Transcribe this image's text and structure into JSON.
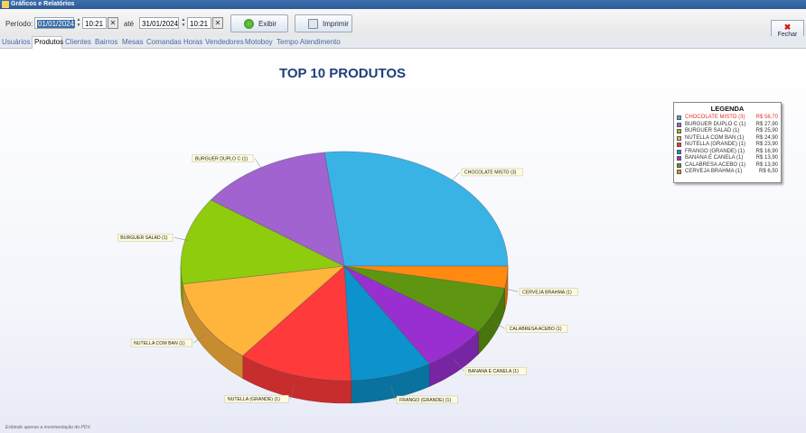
{
  "window": {
    "title": "Gráficos e Relatórios"
  },
  "toolbar": {
    "periodo_label": "Período:",
    "date_from": "01/01/2024",
    "time_from": "10:21",
    "ate_label": "até",
    "date_to": "31/01/2024",
    "time_to": "10:21",
    "exibir_label": "Exibir",
    "imprimir_label": "Imprimir",
    "fechar_label": "Fechar"
  },
  "tabs": [
    "Usuários",
    "Produtos",
    "Clientes",
    "Bairros",
    "Mesas",
    "Comandas",
    "Horas",
    "Vendedores",
    "Motoboy",
    "Tempo Atendimento"
  ],
  "active_tab": "Produtos",
  "footer_note": "Exibindo apenas a movimentação do PDV.",
  "chart_data": {
    "type": "pie",
    "title": "TOP 10 PRODUTOS",
    "legend_title": "LEGENDA",
    "legend_placement": "top-right",
    "slices": [
      {
        "label": "CHOCOLATE MISTO (3)",
        "legend_label": "CHOCOLATE MISTO (3)",
        "value": 56.7,
        "value_text": "R$ 56,70",
        "color": "#39b3e6"
      },
      {
        "label": "CERVEJA BRAHMA (1)",
        "legend_label": "CERVEJA BRAHMA (1)",
        "value": 6.5,
        "value_text": "R$ 6,50",
        "color": "#ff8a0f"
      },
      {
        "label": "CALABRESA ACEBO (1)",
        "legend_label": "CALABRESA ACEBO (1)",
        "value": 13.9,
        "value_text": "R$ 13,90",
        "color": "#5e9611"
      },
      {
        "label": "BANANA E CANELA (1)",
        "legend_label": "BANANA E CANELA (1)",
        "value": 13.9,
        "value_text": "R$ 13,90",
        "color": "#9a2fd1"
      },
      {
        "label": "FRANGO (GRANDE) (1)",
        "legend_label": "FRANGO (GRANDE) (1)",
        "value": 16.9,
        "value_text": "R$ 16,90",
        "color": "#0c92cc"
      },
      {
        "label": "NUTELLA (GRANDE) (1)",
        "legend_label": "NUTELLA (GRANDE) (1)",
        "value": 23.9,
        "value_text": "R$ 23,90",
        "color": "#ff3a3a"
      },
      {
        "label": "NUTELLA COM BAN (1)",
        "legend_label": "NUTELLA COM BAN (1)",
        "value": 24.9,
        "value_text": "R$ 24,90",
        "color": "#ffb43c"
      },
      {
        "label": "BURGUER SALAD (1)",
        "legend_label": "BURGUER SALAD (1)",
        "value": 25.9,
        "value_text": "R$ 25,90",
        "color": "#8fcc0e"
      },
      {
        "label": "BURGUER DUPLO C (1)",
        "legend_label": "BURGUER DUPLO C (1)",
        "value": 27.9,
        "value_text": "R$ 27,90",
        "color": "#a063cf"
      }
    ],
    "legend_order": [
      0,
      8,
      7,
      6,
      5,
      4,
      3,
      2,
      1
    ],
    "highlighted_legend_index": 0
  }
}
